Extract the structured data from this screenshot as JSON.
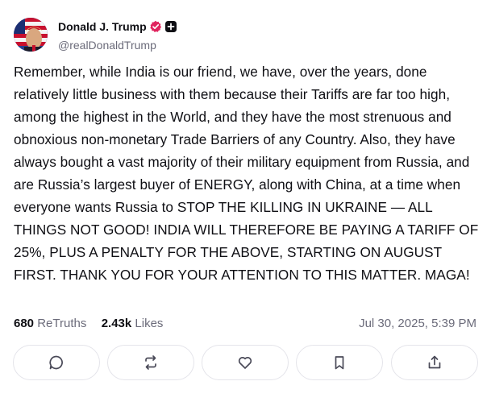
{
  "author": {
    "display_name": "Donald J. Trump",
    "handle": "@realDonaldTrump",
    "verified_badge": "verified-icon",
    "extra_badge": "plus-icon"
  },
  "post": {
    "text": "Remember, while India is our friend, we have, over the years, done relatively little business with them because their Tariffs are far too high, among the highest in the World, and they have the most strenuous and obnoxious non-monetary Trade Barriers of any Country. Also, they have always bought a vast majority of their military equipment from Russia, and are Russia’s largest buyer of ENERGY, along with China, at a time when everyone wants Russia to STOP THE KILLING IN UKRAINE — ALL THINGS NOT GOOD! INDIA WILL THEREFORE BE PAYING A TARIFF OF 25%, PLUS A PENALTY FOR THE ABOVE, STARTING ON AUGUST FIRST. THANK YOU FOR YOUR ATTENTION TO THIS MATTER. MAGA!",
    "retruths_count": "680",
    "retruths_label": "ReTruths",
    "likes_count": "2.43k",
    "likes_label": "Likes",
    "timestamp": "Jul 30, 2025, 5:39 PM"
  },
  "actions": [
    {
      "name": "reply",
      "icon": "reply-icon"
    },
    {
      "name": "retruth",
      "icon": "retruth-icon"
    },
    {
      "name": "like",
      "icon": "heart-icon"
    },
    {
      "name": "bookmark",
      "icon": "bookmark-icon"
    },
    {
      "name": "share",
      "icon": "share-icon"
    }
  ],
  "colors": {
    "text": "#0f0f14",
    "muted": "#6b6b7a",
    "verified": "#e0245e",
    "border": "#e4e4ea"
  }
}
